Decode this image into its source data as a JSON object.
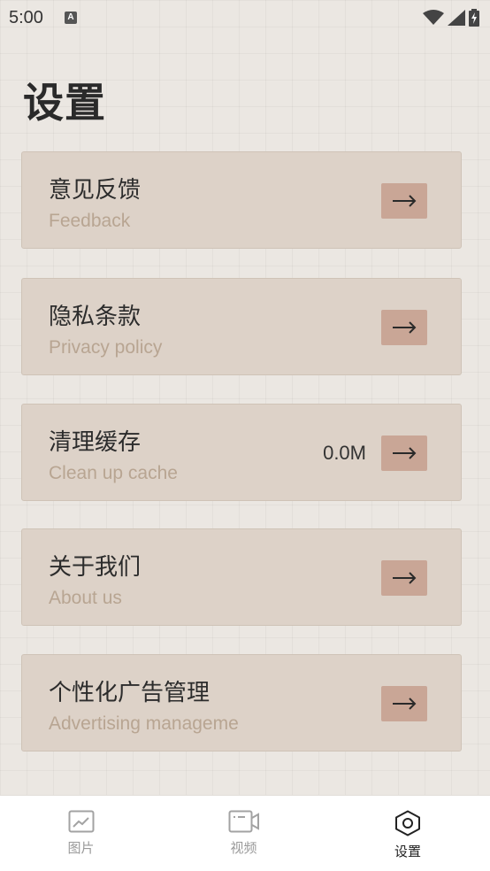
{
  "status_bar": {
    "time": "5:00",
    "notification_badge": "A"
  },
  "page": {
    "title": "设置"
  },
  "settings_items": [
    {
      "title": "意见反馈",
      "subtitle": "Feedback",
      "value": ""
    },
    {
      "title": "隐私条款",
      "subtitle": "Privacy policy",
      "value": ""
    },
    {
      "title": "清理缓存",
      "subtitle": "Clean up cache",
      "value": "0.0M"
    },
    {
      "title": "关于我们",
      "subtitle": "About us",
      "value": ""
    },
    {
      "title": "个性化广告管理",
      "subtitle": "Advertising manageme",
      "value": ""
    }
  ],
  "bottom_nav": {
    "items": [
      {
        "label": "图片",
        "icon": "image-icon",
        "active": false
      },
      {
        "label": "视频",
        "icon": "video-icon",
        "active": false
      },
      {
        "label": "设置",
        "icon": "settings-icon",
        "active": true
      }
    ]
  },
  "colors": {
    "background": "#ebe7e2",
    "card": "#ddd2c8",
    "arrow_button": "#c9a696",
    "subtitle": "#b8a592"
  }
}
